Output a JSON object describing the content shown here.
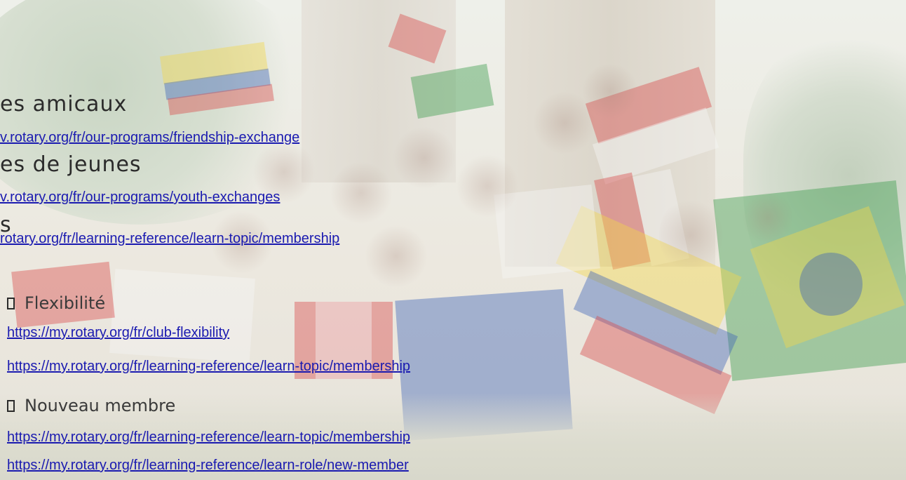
{
  "sections": {
    "friendship": {
      "heading": "es amicaux",
      "link": "v.rotary.org/fr/our-programs/friendship-exchange"
    },
    "youth": {
      "heading": "es de jeunes",
      "link": "v.rotary.org/fr/our-programs/youth-exchanges"
    },
    "membership": {
      "heading": "s",
      "link": "rotary.org/fr/learning-reference/learn-topic/membership"
    },
    "flexibility": {
      "heading": "Flexibilité",
      "links": [
        "https://my.rotary.org/fr/club-flexibility",
        "https://my.rotary.org/fr/learning-reference/learn-topic/membership"
      ]
    },
    "new_member": {
      "heading": "Nouveau membre",
      "links": [
        "https://my.rotary.org/fr/learning-reference/learn-topic/membership",
        "https://my.rotary.org/fr/learning-reference/learn-role/new-member"
      ]
    }
  },
  "colors": {
    "link": "#1a1ab0",
    "text": "#2b2b2b"
  }
}
